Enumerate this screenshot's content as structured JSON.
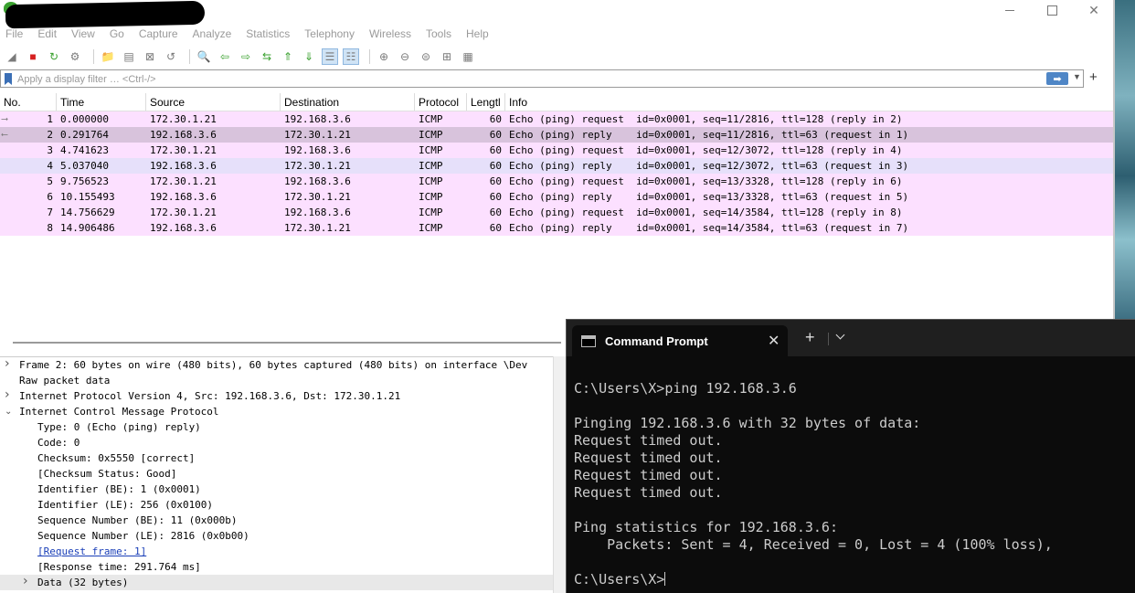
{
  "wireshark": {
    "menu": [
      "File",
      "Edit",
      "View",
      "Go",
      "Capture",
      "Analyze",
      "Statistics",
      "Telephony",
      "Wireless",
      "Tools",
      "Help"
    ],
    "toolbar_icons": [
      "shark-fin-start-icon",
      "stop-capture-icon",
      "restart-capture-icon",
      "capture-options-icon",
      "open-file-icon",
      "save-file-icon",
      "close-file-icon",
      "reload-file-icon",
      "find-packet-icon",
      "go-back-icon",
      "go-forward-icon",
      "go-to-packet-icon",
      "go-first-icon",
      "go-last-icon",
      "autoscroll-icon",
      "colorize-icon",
      "zoom-in-icon",
      "zoom-out-icon",
      "normal-size-icon",
      "resize-columns-icon",
      "layout-icon"
    ],
    "filter": {
      "placeholder": "Apply a display filter … <Ctrl-/>",
      "add_label": "+"
    },
    "columns": {
      "no": "No.",
      "time": "Time",
      "source": "Source",
      "destination": "Destination",
      "protocol": "Protocol",
      "length": "Lengtl",
      "info": "Info"
    },
    "packets": [
      {
        "no": "1",
        "time": "0.000000",
        "source": "172.30.1.21",
        "destination": "192.168.3.6",
        "protocol": "ICMP",
        "length": "60",
        "info": "Echo (ping) request  id=0x0001, seq=11/2816, ttl=128 (reply in 2)"
      },
      {
        "no": "2",
        "time": "0.291764",
        "source": "192.168.3.6",
        "destination": "172.30.1.21",
        "protocol": "ICMP",
        "length": "60",
        "info": "Echo (ping) reply    id=0x0001, seq=11/2816, ttl=63 (request in 1)"
      },
      {
        "no": "3",
        "time": "4.741623",
        "source": "172.30.1.21",
        "destination": "192.168.3.6",
        "protocol": "ICMP",
        "length": "60",
        "info": "Echo (ping) request  id=0x0001, seq=12/3072, ttl=128 (reply in 4)"
      },
      {
        "no": "4",
        "time": "5.037040",
        "source": "192.168.3.6",
        "destination": "172.30.1.21",
        "protocol": "ICMP",
        "length": "60",
        "info": "Echo (ping) reply    id=0x0001, seq=12/3072, ttl=63 (request in 3)"
      },
      {
        "no": "5",
        "time": "9.756523",
        "source": "172.30.1.21",
        "destination": "192.168.3.6",
        "protocol": "ICMP",
        "length": "60",
        "info": "Echo (ping) request  id=0x0001, seq=13/3328, ttl=128 (reply in 6)"
      },
      {
        "no": "6",
        "time": "10.155493",
        "source": "192.168.3.6",
        "destination": "172.30.1.21",
        "protocol": "ICMP",
        "length": "60",
        "info": "Echo (ping) reply    id=0x0001, seq=13/3328, ttl=63 (request in 5)"
      },
      {
        "no": "7",
        "time": "14.756629",
        "source": "172.30.1.21",
        "destination": "192.168.3.6",
        "protocol": "ICMP",
        "length": "60",
        "info": "Echo (ping) request  id=0x0001, seq=14/3584, ttl=128 (reply in 8)"
      },
      {
        "no": "8",
        "time": "14.906486",
        "source": "192.168.3.6",
        "destination": "172.30.1.21",
        "protocol": "ICMP",
        "length": "60",
        "info": "Echo (ping) reply    id=0x0001, seq=14/3584, ttl=63 (request in 7)"
      }
    ],
    "details": [
      {
        "text": "Frame 2: 60 bytes on wire (480 bits), 60 bytes captured (480 bits) on interface \\Dev",
        "level": 0,
        "chevron": "collapsed"
      },
      {
        "text": "Raw packet data",
        "level": 0,
        "chevron": "none"
      },
      {
        "text": "Internet Protocol Version 4, Src: 192.168.3.6, Dst: 172.30.1.21",
        "level": 0,
        "chevron": "collapsed"
      },
      {
        "text": "Internet Control Message Protocol",
        "level": 0,
        "chevron": "expanded"
      },
      {
        "text": "Type: 0 (Echo (ping) reply)",
        "level": 1,
        "chevron": "none"
      },
      {
        "text": "Code: 0",
        "level": 1,
        "chevron": "none"
      },
      {
        "text": "Checksum: 0x5550 [correct]",
        "level": 1,
        "chevron": "none"
      },
      {
        "text": "[Checksum Status: Good]",
        "level": 1,
        "chevron": "none"
      },
      {
        "text": "Identifier (BE): 1 (0x0001)",
        "level": 1,
        "chevron": "none"
      },
      {
        "text": "Identifier (LE): 256 (0x0100)",
        "level": 1,
        "chevron": "none"
      },
      {
        "text": "Sequence Number (BE): 11 (0x000b)",
        "level": 1,
        "chevron": "none"
      },
      {
        "text": "Sequence Number (LE): 2816 (0x0b00)",
        "level": 1,
        "chevron": "none"
      },
      {
        "text": "[Request frame: 1]",
        "level": 1,
        "chevron": "none",
        "link": true
      },
      {
        "text": "[Response time: 291.764 ms]",
        "level": 1,
        "chevron": "none"
      },
      {
        "text": "Data (32 bytes)",
        "level": 1,
        "chevron": "collapsed"
      }
    ]
  },
  "cmd": {
    "tab_title": "Command Prompt",
    "lines": [
      "C:\\Users\\X>ping 192.168.3.6",
      "",
      "Pinging 192.168.3.6 with 32 bytes of data:",
      "Request timed out.",
      "Request timed out.",
      "Request timed out.",
      "Request timed out.",
      "",
      "Ping statistics for 192.168.3.6:",
      "    Packets: Sent = 4, Received = 0, Lost = 4 (100% loss),",
      ""
    ],
    "prompt": "C:\\Users\\X>"
  }
}
